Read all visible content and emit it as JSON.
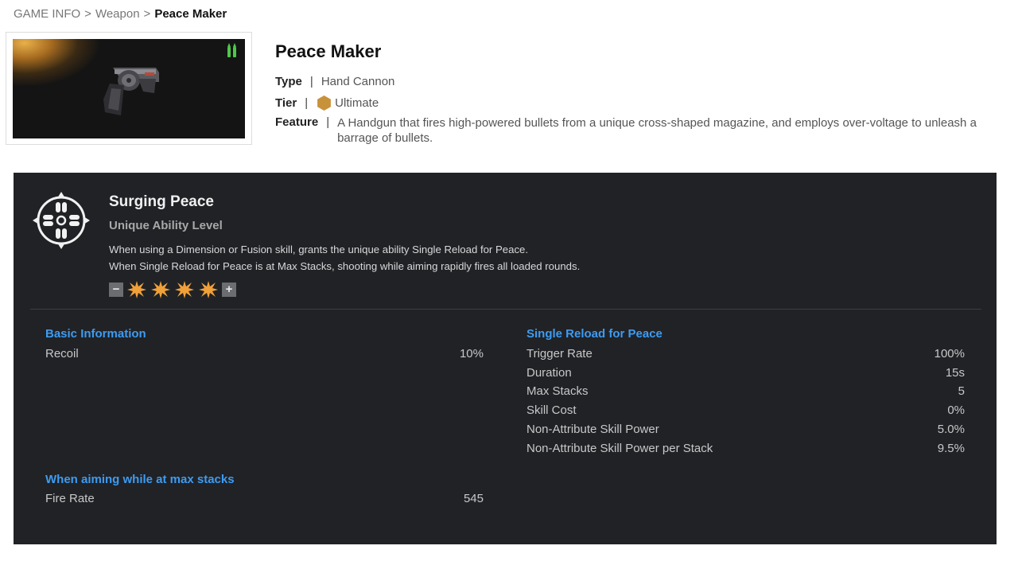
{
  "breadcrumb": {
    "items": [
      "GAME INFO",
      "Weapon"
    ],
    "separator": ">",
    "current": "Peace Maker"
  },
  "item": {
    "thumbnail_icon": "revolver-image",
    "ammo_icon": "green-ammo-icon",
    "title": "Peace Maker",
    "type_label": "Type",
    "type_value": "Hand Cannon",
    "tier_label": "Tier",
    "tier_value": "Ultimate",
    "tier_color": "#c8923a",
    "feature_label": "Feature",
    "feature_value": "A Handgun that fires high-powered bullets from a unique cross-shaped magazine, and employs over-voltage to unleash a barrage of bullets."
  },
  "ability": {
    "icon": "crosshair-magazine-icon",
    "name": "Surging Peace",
    "level_label": "Unique Ability Level",
    "desc_line1": "When using a Dimension or Fusion skill, grants the unique ability Single Reload for Peace.",
    "desc_line2": "When Single Reload for Peace is at Max Stacks, shooting while aiming rapidly fires all loaded rounds.",
    "level": 4,
    "level_max": 4,
    "minus_label": "−",
    "plus_label": "+",
    "star_color": "#f0a13a"
  },
  "basic_info": {
    "title": "Basic Information",
    "stats": [
      {
        "label": "Recoil",
        "value": "10%"
      }
    ]
  },
  "max_stacks": {
    "title": "When aiming while at max stacks",
    "stats": [
      {
        "label": "Fire Rate",
        "value": "545"
      }
    ]
  },
  "single_reload": {
    "title": "Single Reload for Peace",
    "stats": [
      {
        "label": "Trigger Rate",
        "value": "100%"
      },
      {
        "label": "Duration",
        "value": "15s"
      },
      {
        "label": "Max Stacks",
        "value": "5"
      },
      {
        "label": "Skill Cost",
        "value": "0%"
      },
      {
        "label": "Non-Attribute Skill Power",
        "value": "5.0%"
      },
      {
        "label": "Non-Attribute Skill Power per Stack",
        "value": "9.5%"
      }
    ]
  },
  "colors": {
    "panel_bg": "#202226",
    "accent_blue": "#3e9bf1"
  }
}
